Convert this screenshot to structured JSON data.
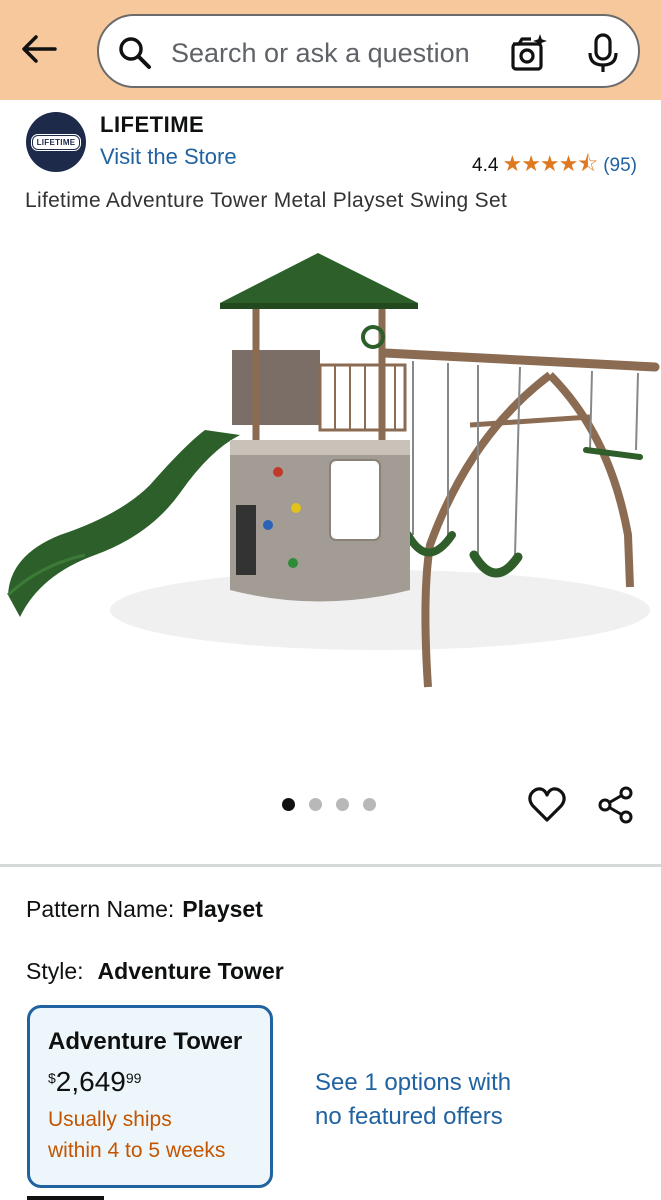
{
  "header": {
    "search_placeholder": "Search or ask a question"
  },
  "brand": {
    "logo_text": "LIFETIME",
    "name": "LIFETIME",
    "visit_store": "Visit the Store",
    "rating_value": "4.4",
    "stars": "★★★★⯪",
    "rating_count": "(95)"
  },
  "product": {
    "title": "Lifetime Adventure Tower Metal Playset Swing Set",
    "image_count": 4,
    "active_image": 1
  },
  "variations": {
    "pattern_label": "Pattern Name:",
    "pattern_value": "Playset",
    "style_label": "Style:",
    "style_value": "Adventure Tower"
  },
  "option_card": {
    "title": "Adventure Tower",
    "price_symbol": "$",
    "price_whole": "2,649",
    "price_fraction": "99",
    "ships_line1": "Usually ships",
    "ships_line2": "within 4 to 5 weeks"
  },
  "see_options": {
    "line1": "See 1 options with",
    "line2": "no featured offers"
  },
  "colors": {
    "header_bg": "#f7c89b",
    "link": "#2162a1",
    "star": "#de7921",
    "ships": "#c45500",
    "card_bg": "#edf6fb"
  }
}
